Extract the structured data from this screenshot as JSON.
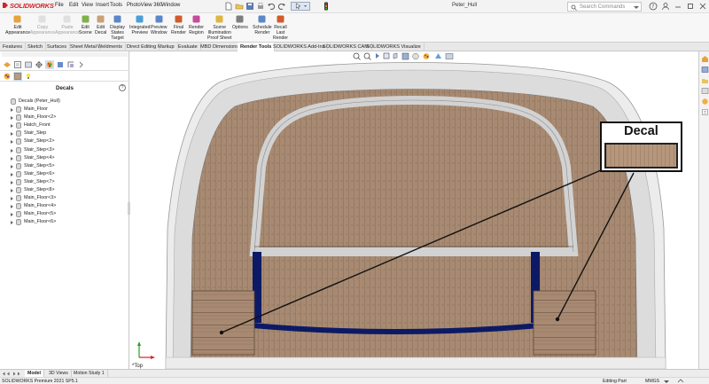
{
  "app": {
    "logo_text": "SOLIDWORKS",
    "document_title": "Peter_Hull",
    "menus": [
      "File",
      "Edit",
      "View",
      "Insert",
      "Tools",
      "PhotoView 360",
      "Window"
    ],
    "search_placeholder": "Search Commands"
  },
  "commands": [
    {
      "l1": "Edit",
      "l2": "Appearance",
      "l3": "",
      "enabled": true,
      "icon": "edit-appearance-icon"
    },
    {
      "l1": "Copy",
      "l2": "Appearance",
      "l3": "",
      "enabled": false,
      "icon": "copy-appearance-icon"
    },
    {
      "l1": "Paste",
      "l2": "Appearance",
      "l3": "",
      "enabled": false,
      "icon": "paste-appearance-icon"
    },
    {
      "l1": "Edit",
      "l2": "Scene",
      "l3": "",
      "enabled": true,
      "icon": "edit-scene-icon"
    },
    {
      "l1": "Edit",
      "l2": "Decal",
      "l3": "",
      "enabled": true,
      "icon": "edit-decal-icon"
    },
    {
      "l1": "Display",
      "l2": "States",
      "l3": "Target",
      "enabled": true,
      "icon": "display-states-icon"
    },
    {
      "l1": "Integrated",
      "l2": "Preview",
      "l3": "",
      "enabled": true,
      "icon": "integrated-preview-icon"
    },
    {
      "l1": "Preview",
      "l2": "Window",
      "l3": "",
      "enabled": true,
      "icon": "preview-window-icon"
    },
    {
      "l1": "Final",
      "l2": "Render",
      "l3": "",
      "enabled": true,
      "icon": "final-render-icon"
    },
    {
      "l1": "Render",
      "l2": "Region",
      "l3": "",
      "enabled": true,
      "icon": "render-region-icon"
    },
    {
      "l1": "Scene",
      "l2": "Illumination",
      "l3": "Proof Sheet",
      "enabled": true,
      "icon": "scene-illumination-icon"
    },
    {
      "l1": "Options",
      "l2": "",
      "l3": "",
      "enabled": true,
      "icon": "options-icon"
    },
    {
      "l1": "Schedule",
      "l2": "Render",
      "l3": "",
      "enabled": true,
      "icon": "schedule-render-icon"
    },
    {
      "l1": "Recall",
      "l2": "Last",
      "l3": "Render",
      "enabled": true,
      "icon": "recall-last-render-icon"
    }
  ],
  "tabs": [
    "Features",
    "Sketch",
    "Surfaces",
    "Sheet Metal",
    "Weldments",
    "Direct Editing",
    "Markup",
    "Evaluate",
    "MBD Dimensions",
    "Render Tools",
    "SOLIDWORKS Add-Ins",
    "SOLIDWORKS CAM",
    "SOLIDWORKS Visualize"
  ],
  "active_tab": "Render Tools",
  "panel": {
    "title": "Decals",
    "help": "?",
    "root": "Decals (Peter_Hull)",
    "items": [
      "Main_Floor",
      "Main_Floor<2>",
      "Hatch_Front",
      "Stair_Step",
      "Stair_Step<2>",
      "Stair_Step<3>",
      "Stair_Step<4>",
      "Stair_Step<5>",
      "Stair_Step<6>",
      "Stair_Step<7>",
      "Stair_Step<8>",
      "Main_Floor<3>",
      "Main_Floor<4>",
      "Main_Floor<5>",
      "Main_Floor<6>"
    ]
  },
  "viewport": {
    "callout_label": "Decal",
    "view_label": "*Top",
    "colors": {
      "deck": "#a88a72",
      "deck_line": "#6e5848",
      "hull": "#d9d9d9",
      "navy": "#0c1a66"
    }
  },
  "bottom_tabs": [
    "Model",
    "3D Views",
    "Motion Study 1"
  ],
  "status": {
    "left": "SOLIDWORKS Premium 2021 SP5.1",
    "mode": "Editing Part",
    "units": "MMGS"
  }
}
